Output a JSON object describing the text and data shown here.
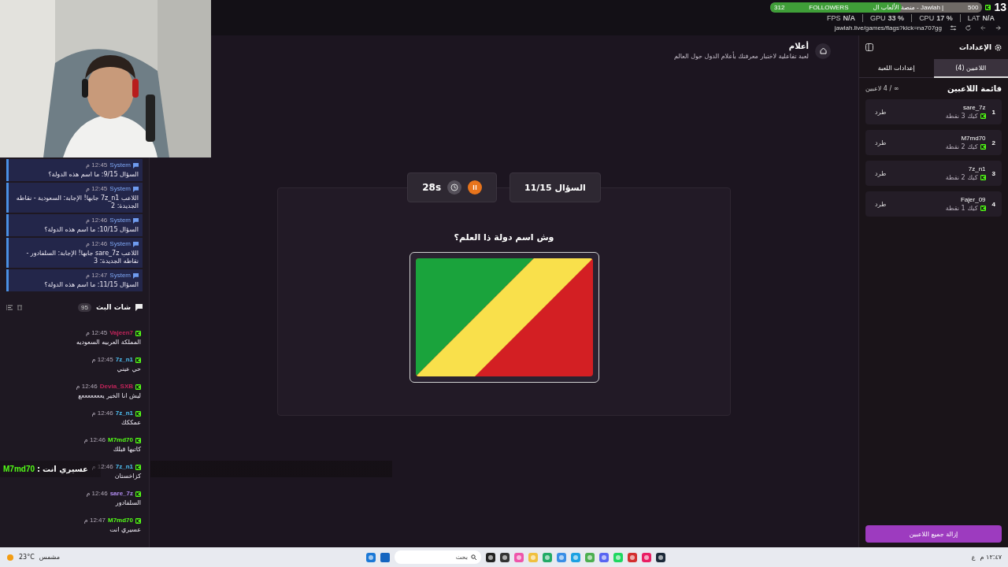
{
  "overlay": {
    "followers": {
      "count": "312",
      "label": "FOLLOWERS",
      "goal": "500",
      "level": 0.62
    },
    "page_title": "منصة الألعاب ال - Jawlah |",
    "viewers": "13",
    "stats": [
      {
        "label": "LAT",
        "value": "N/A"
      },
      {
        "label": "CPU",
        "value": "17 %"
      },
      {
        "label": "GPU",
        "value": "33 %"
      },
      {
        "label": "FPS",
        "value": "N/A"
      }
    ],
    "alert": {
      "name": "M7md70",
      "separator": ":",
      "message": "عسيري انت"
    }
  },
  "browser": {
    "url": "jawlah.live/games/flags?kick=na707gg"
  },
  "system_messages": [
    {
      "sender": "System",
      "time": "12:45 م",
      "text": "السؤال 9/15: ما اسم هذه الدولة؟"
    },
    {
      "sender": "System",
      "time": "12:45 م",
      "text": "اللاعب 7z_n1 جابها! الإجابة: السعودية - نقاطه الجديدة: 2"
    },
    {
      "sender": "System",
      "time": "12:46 م",
      "text": "السؤال 10/15: ما اسم هذه الدولة؟"
    },
    {
      "sender": "System",
      "time": "12:46 م",
      "text": "اللاعب sare_7z جابها! الإجابة: السلفادور - نقاطه الجديدة: 3"
    },
    {
      "sender": "System",
      "time": "12:47 م",
      "text": "السؤال 11/15: ما اسم هذه الدولة؟"
    }
  ],
  "chat": {
    "title": "شات البث",
    "count": "95",
    "messages": [
      {
        "name": "Vajeen7",
        "color": "#c0245a",
        "time": "12:45 م",
        "text": "المملكة العربيه السعوديه"
      },
      {
        "name": "7z_n1",
        "color": "#4fc3f7",
        "time": "12:45 م",
        "text": "حي عيني"
      },
      {
        "name": "Devia_SXB",
        "color": "#c0245a",
        "time": "12:46 م",
        "text": "ليش انا الخير يعععععععع"
      },
      {
        "name": "7z_n1",
        "color": "#4fc3f7",
        "time": "12:46 م",
        "text": "عمككك"
      },
      {
        "name": "M7md70",
        "color": "#53fc18",
        "time": "12:46 م",
        "text": "كاتبها قبلك"
      },
      {
        "name": "7z_n1",
        "color": "#4fc3f7",
        "time": "12:46 م",
        "text": "كزاخستان"
      },
      {
        "name": "sare_7z",
        "color": "#b18cf0",
        "time": "12:46 م",
        "text": "السلفادور"
      },
      {
        "name": "M7md70",
        "color": "#53fc18",
        "time": "12:47 م",
        "text": "عسيري انت"
      }
    ]
  },
  "game": {
    "title": "أعلام",
    "subtitle": "لعبة تفاعلية لاختبار معرفتك بأعلام الدول حول العالم",
    "timer": "28s",
    "question_counter": "السؤال 11/15",
    "question": "وش اسم دولة ذا العلم؟"
  },
  "settings": {
    "title": "الإعدادات",
    "tabs": [
      {
        "label": "اللاعبين (4)",
        "selected": true
      },
      {
        "label": "إعدادات اللعبة",
        "selected": false
      }
    ],
    "list_title": "قائمة اللاعبين",
    "capacity": "∞ / 4 لاعبين",
    "players": [
      {
        "rank": "1",
        "name": "sare_7z",
        "platform": "كيك",
        "points": "3 نقطة",
        "action": "طرد"
      },
      {
        "rank": "2",
        "name": "M7md70",
        "platform": "كيك",
        "points": "2 نقطة",
        "action": "طرد"
      },
      {
        "rank": "3",
        "name": "7z_n1",
        "platform": "كيك",
        "points": "2 نقطة",
        "action": "طرد"
      },
      {
        "rank": "4",
        "name": "Fajer_09",
        "platform": "كيك",
        "points": "1 نقطة",
        "action": "طرد"
      }
    ],
    "remove_all": "إزالة جميع اللاعبين"
  },
  "taskbar": {
    "search_placeholder": "بحث",
    "temperature": "23°C",
    "condition": "مشمس",
    "clock": "١٢:٤٧ م",
    "keyboard": "ع"
  }
}
